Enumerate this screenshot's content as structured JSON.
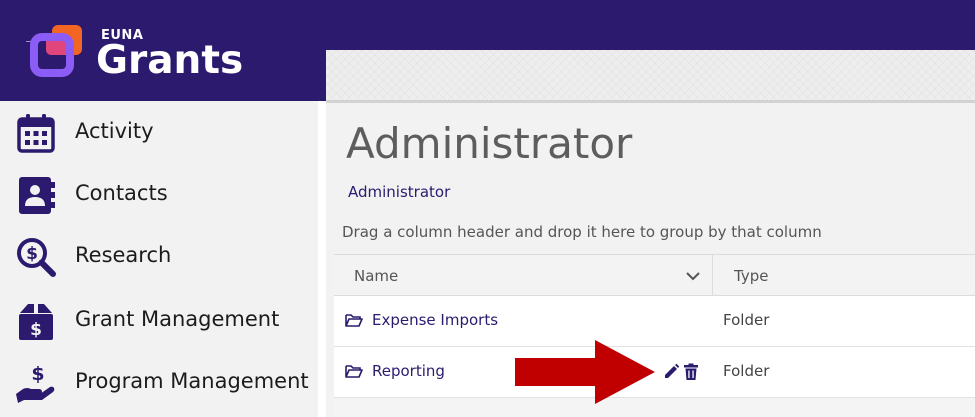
{
  "brand": {
    "company": "EUNA",
    "product": "Grants"
  },
  "sidebar": {
    "items": [
      {
        "label": "Activity",
        "icon": "calendar-icon"
      },
      {
        "label": "Contacts",
        "icon": "contact-book-icon"
      },
      {
        "label": "Research",
        "icon": "search-dollar-icon"
      },
      {
        "label": "Grant Management",
        "icon": "box-dollar-icon"
      },
      {
        "label": "Program Management",
        "icon": "hand-dollar-icon"
      }
    ]
  },
  "main": {
    "title": "Administrator",
    "breadcrumb": "Administrator",
    "group_hint": "Drag a column header and drop it here to group by that column",
    "grid": {
      "columns": [
        {
          "label": "Name"
        },
        {
          "label": "Type"
        }
      ],
      "rows": [
        {
          "name": "Expense Imports",
          "type": "Folder",
          "icon": "folder-open-icon"
        },
        {
          "name": "Reporting",
          "type": "Folder",
          "icon": "folder-open-icon",
          "actions": [
            "pencil-icon",
            "trash-icon"
          ]
        }
      ]
    }
  },
  "colors": {
    "brand_purple": "#2b1a6e",
    "logo_orange": "#f26522",
    "logo_violet": "#8b5cf6",
    "annotation_arrow": "#c00000"
  }
}
